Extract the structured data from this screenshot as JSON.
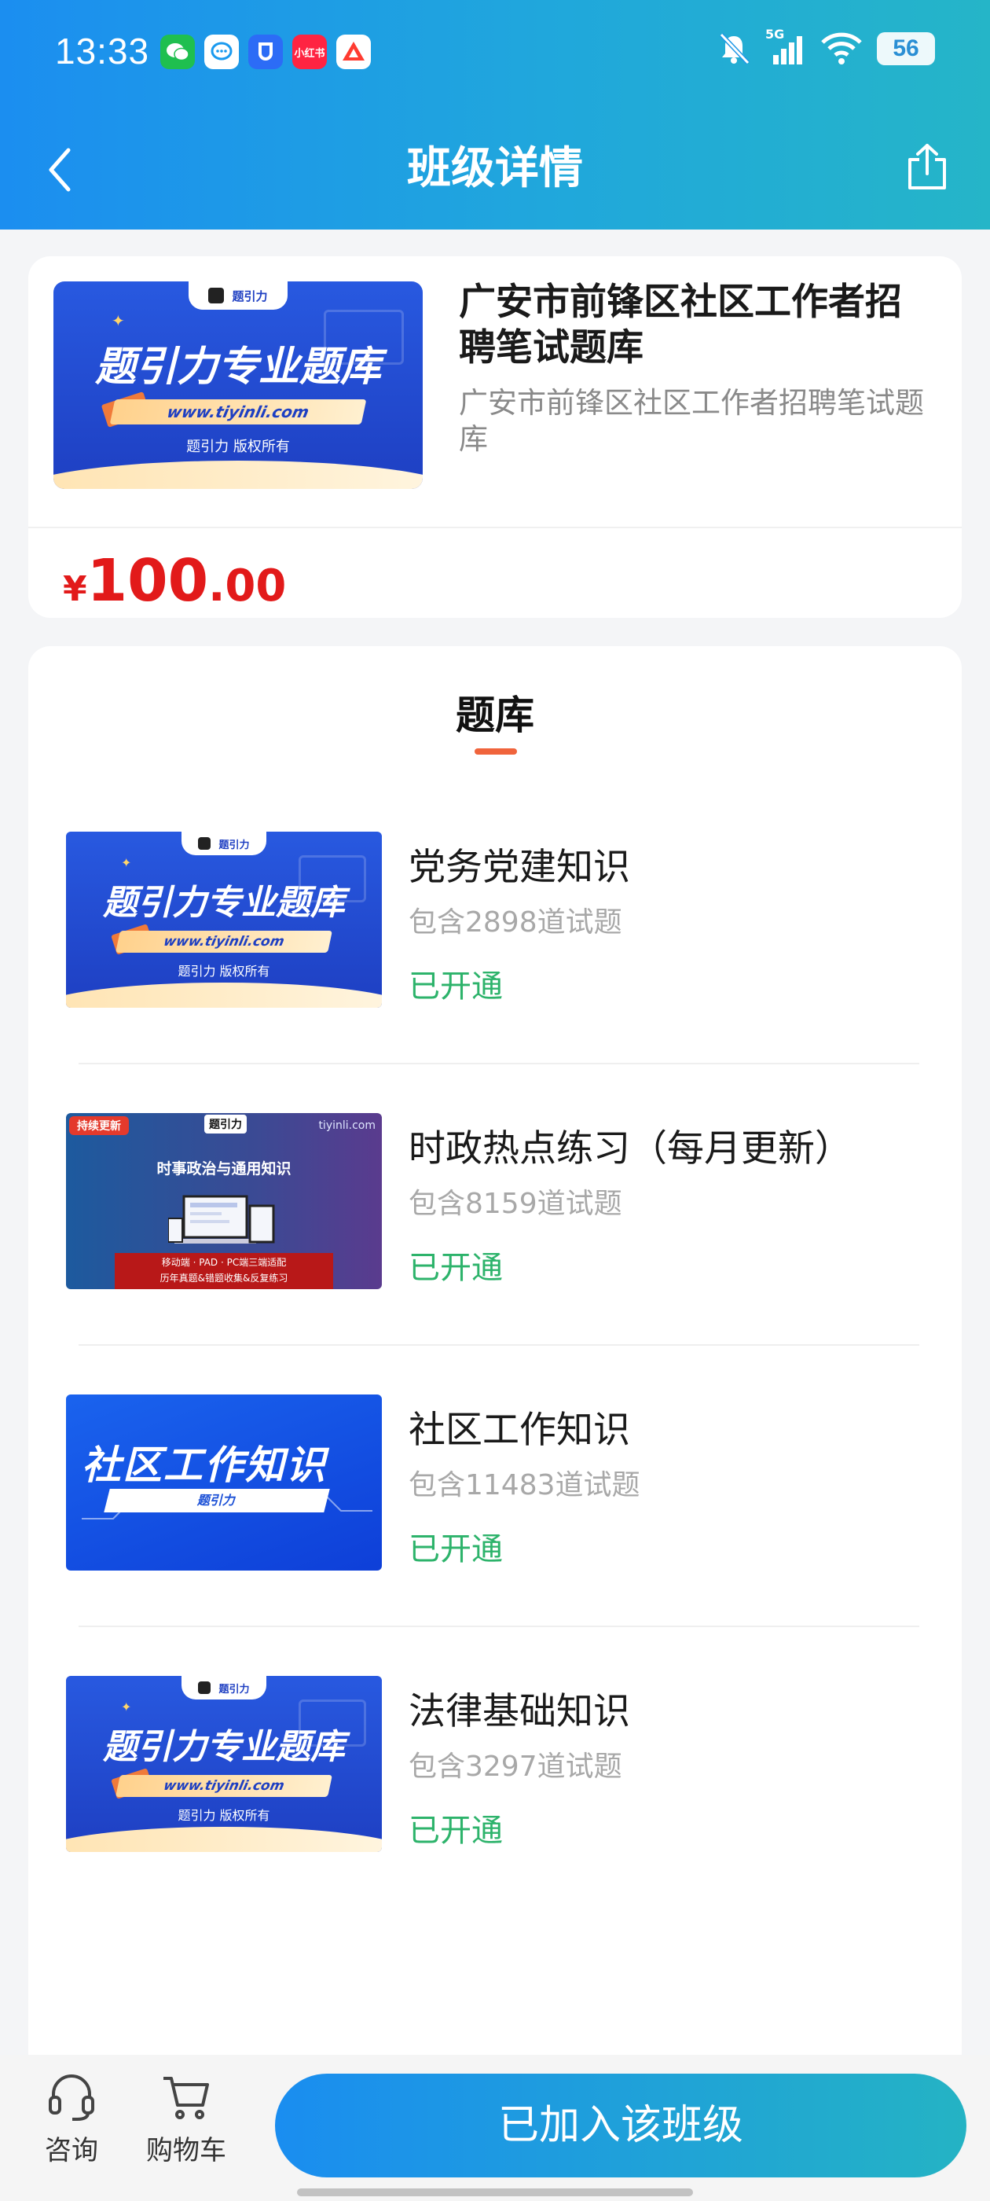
{
  "status": {
    "time": "13:33",
    "battery": "56",
    "network": "5G",
    "app_icons": [
      {
        "name": "wechat-icon",
        "color": "#1fbf4f",
        "glyph": "✉"
      },
      {
        "name": "messages-icon",
        "color": "#ffffff",
        "glyph": "✉"
      },
      {
        "name": "u-app-icon",
        "color": "#2c6cf6",
        "glyph": "U"
      },
      {
        "name": "xiaohongshu-icon",
        "color": "#ff2442",
        "label": "小红书"
      },
      {
        "name": "a-app-icon",
        "color": "#ff3b30",
        "glyph": "A"
      }
    ]
  },
  "nav": {
    "title": "班级详情"
  },
  "class_info": {
    "banner": {
      "tab_label": "题引力",
      "title": "题引力专业题库",
      "url": "www.tiyinli.com",
      "copyright": "题引力 版权所有"
    },
    "title": "广安市前锋区社区工作者招聘笔试题库",
    "description": "广安市前锋区社区工作者招聘笔试题库",
    "price_symbol": "¥",
    "price_integer": "100",
    "price_decimal": ".00"
  },
  "bank_section": {
    "title": "题库",
    "items": [
      {
        "name": "党务党建知识",
        "count": "包含2898道试题",
        "status": "已开通",
        "thumb": "standard",
        "banner": {
          "tab_label": "题引力",
          "title": "题引力专业题库",
          "url": "www.tiyinli.com",
          "copyright": "题引力 版权所有"
        }
      },
      {
        "name": "时政热点练习（每月更新）",
        "count": "包含8159道试题",
        "status": "已开通",
        "thumb": "politics",
        "banner": {
          "tag": "持续更新",
          "logo_text": "题引力",
          "site": "tiyinli.com",
          "title": "时事政治与通用知识",
          "bar_line1": "移动端 · PAD · PC端三端适配",
          "bar_line2": "历年真题&错题收集&反复练习"
        }
      },
      {
        "name": "社区工作知识",
        "count": "包含11483道试题",
        "status": "已开通",
        "thumb": "community",
        "banner": {
          "title": "社区工作知识",
          "pill": "题引力"
        }
      },
      {
        "name": "法律基础知识",
        "count": "包含3297道试题",
        "status": "已开通",
        "thumb": "standard",
        "banner": {
          "tab_label": "题引力",
          "title": "题引力专业题库",
          "url": "www.tiyinli.com",
          "copyright": "题引力 版权所有"
        }
      }
    ]
  },
  "bottom_bar": {
    "consult_label": "咨询",
    "cart_label": "购物车",
    "join_label": "已加入该班级"
  },
  "colors": {
    "header_start": "#1b8ef0",
    "header_end": "#25b5c8",
    "price": "#e21a1a",
    "status_open": "#2db36b",
    "tab_indicator": "#f0643c"
  }
}
